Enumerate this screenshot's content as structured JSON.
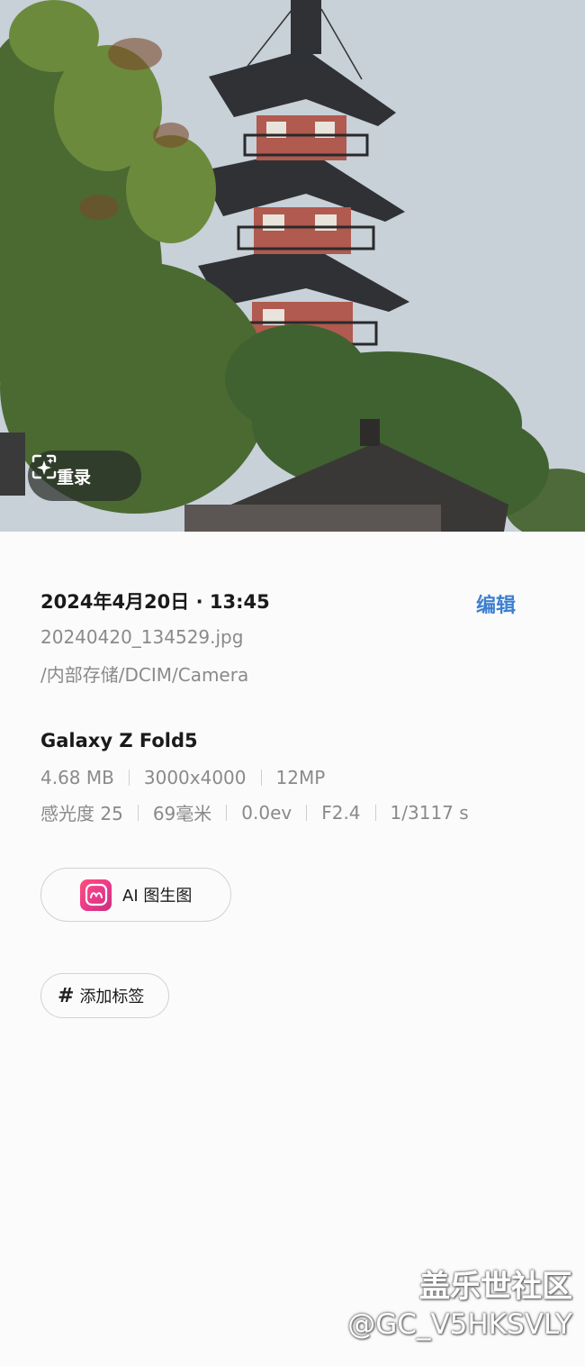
{
  "photo": {
    "remaster_button_label": "重录",
    "remaster_icon": "sparkle-frame-icon"
  },
  "details": {
    "datetime": "2024年4月20日 · 13:45",
    "edit_label": "编辑",
    "filename": "20240420_134529.jpg",
    "path": "/内部存储/DCIM/Camera",
    "device": "Galaxy Z Fold5",
    "specs_row1": [
      "4.68 MB",
      "3000x4000",
      "12MP"
    ],
    "specs_row2": [
      "感光度 25",
      "69毫米",
      "0.0ev",
      "F2.4",
      "1/3117 s"
    ]
  },
  "actions": {
    "ai_button_label": "AI 图生图",
    "ai_icon": "ai-app-icon",
    "tag_hash": "#",
    "tag_button_label": "添加标签"
  },
  "watermark": {
    "line1": "盖乐世社区",
    "line2": "@GC_V5HKSVLY"
  },
  "colors": {
    "accent": "#3d7fd0",
    "background": "#fbfbfb",
    "secondary_text": "#8a8a8a"
  }
}
